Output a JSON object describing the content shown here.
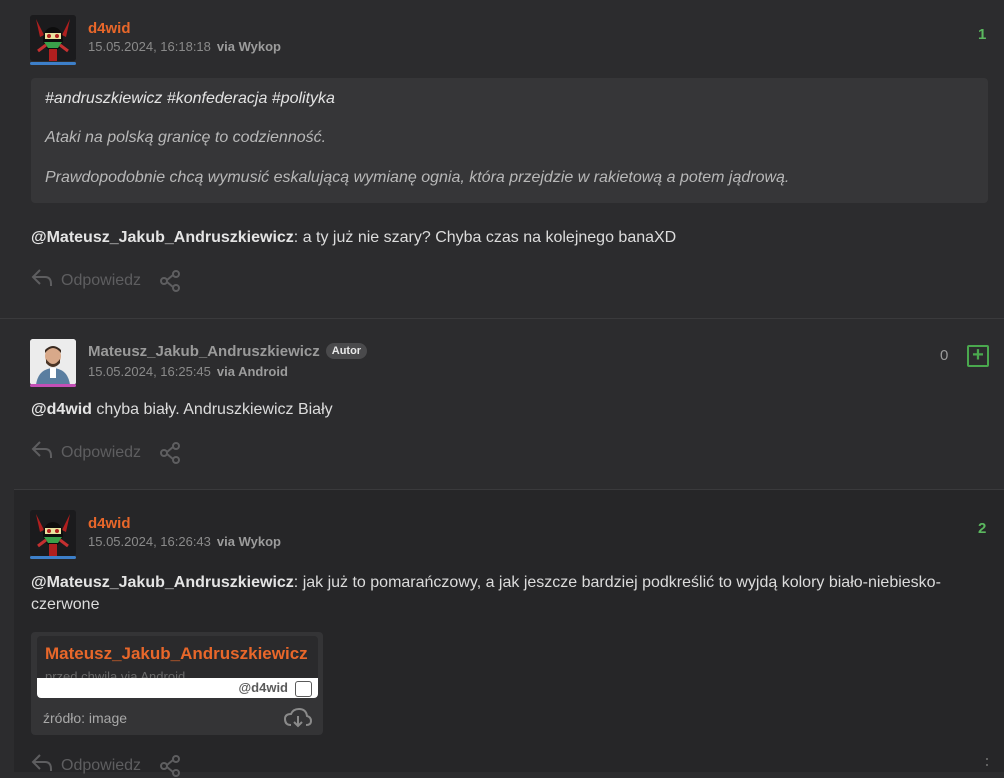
{
  "comments": [
    {
      "username": "d4wid",
      "username_color": "#e8672a",
      "avatar_bar_color": "#3d7fc9",
      "timestamp": "15.05.2024, 16:18:18",
      "via": "via Wykop",
      "score": "1",
      "score_color": "#5bb85f",
      "quote": {
        "tags": "#andruszkiewicz #konfederacja #polityka",
        "lines": [
          "Ataki na polską granicę to codzienność.",
          "Prawdopodobnie chcą wymusić eskalującą wymianę ognia, która przejdzie w rakietową a potem jądrową."
        ]
      },
      "mention": "@Mateusz_Jakub_Andruszkiewicz",
      "text": ": a ty już nie szary? Chyba czas na kolejnego banaXD",
      "reply_label": "Odpowiedz"
    },
    {
      "username": "Mateusz_Jakub_Andruszkiewicz",
      "username_color": "#9a9a9a",
      "avatar_bar_color": "#c44fb6",
      "badge": "Autor",
      "timestamp": "15.05.2024, 16:25:45",
      "via": "via Android",
      "score": "0",
      "score_color": "#9a9a9a",
      "mention": "@d4wid",
      "text": " chyba biały. Andruszkiewicz Biały",
      "reply_label": "Odpowiedz"
    },
    {
      "username": "d4wid",
      "username_color": "#e8672a",
      "avatar_bar_color": "#3d7fc9",
      "timestamp": "15.05.2024, 16:26:43",
      "via": "via Wykop",
      "score": "2",
      "score_color": "#5bb85f",
      "mention": "@Mateusz_Jakub_Andruszkiewicz",
      "text_line1": ": jak już to pomarańczowy, a jak jeszcze bardziej podkreślić to wyjdą kolory biało-niebiesko-",
      "text_line2": "czerwone",
      "embed": {
        "inner_username": "Mateusz_Jakub_Andruszkiewicz",
        "inner_faded": "przed chwilą via Android",
        "inner_mention": "@d4wid",
        "source": "źródło: image"
      },
      "reply_label": "Odpowiedz"
    }
  ]
}
